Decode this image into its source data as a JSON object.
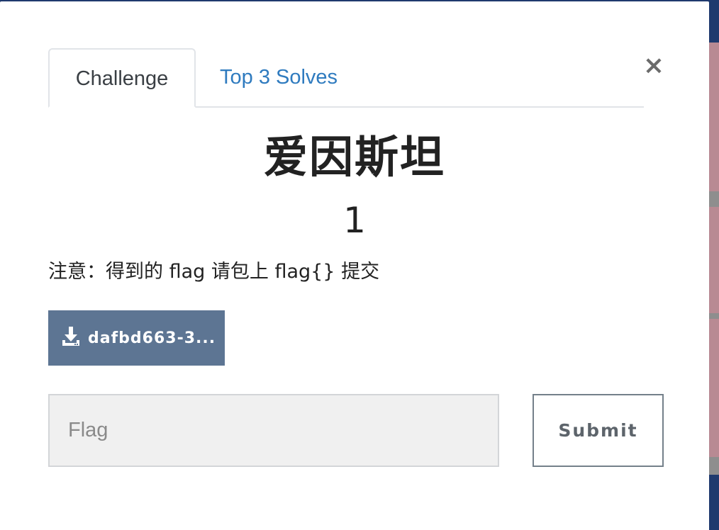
{
  "modal": {
    "tabs": [
      {
        "label": "Challenge",
        "active": true
      },
      {
        "label": "Top 3 Solves",
        "active": false
      }
    ],
    "close_label": "×",
    "challenge": {
      "name": "爱因斯坦",
      "points": "1",
      "description": "注意：得到的 flag 请包上 flag{} 提交",
      "file_label": "dafbd663-3..."
    },
    "flag_placeholder": "Flag",
    "submit_label": "Submit"
  },
  "colors": {
    "tab_link": "#2f7bbf",
    "file_button": "#5d7593",
    "background_strip": "#b88a93",
    "background_nav": "#1f3a6e"
  },
  "icons": {
    "close": "close-icon",
    "download": "download-icon"
  }
}
